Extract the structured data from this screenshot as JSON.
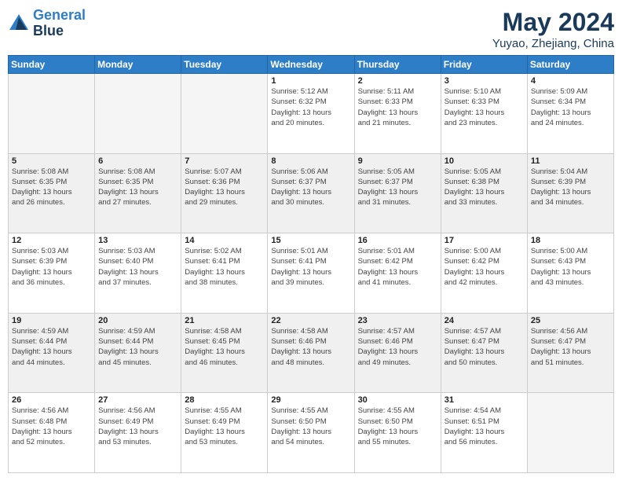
{
  "logo": {
    "line1": "General",
    "line2": "Blue"
  },
  "title": "May 2024",
  "subtitle": "Yuyao, Zhejiang, China",
  "days_header": [
    "Sunday",
    "Monday",
    "Tuesday",
    "Wednesday",
    "Thursday",
    "Friday",
    "Saturday"
  ],
  "weeks": [
    [
      {
        "day": "",
        "info": "",
        "empty": true
      },
      {
        "day": "",
        "info": "",
        "empty": true
      },
      {
        "day": "",
        "info": "",
        "empty": true
      },
      {
        "day": "1",
        "info": "Sunrise: 5:12 AM\nSunset: 6:32 PM\nDaylight: 13 hours\nand 20 minutes.",
        "empty": false
      },
      {
        "day": "2",
        "info": "Sunrise: 5:11 AM\nSunset: 6:33 PM\nDaylight: 13 hours\nand 21 minutes.",
        "empty": false
      },
      {
        "day": "3",
        "info": "Sunrise: 5:10 AM\nSunset: 6:33 PM\nDaylight: 13 hours\nand 23 minutes.",
        "empty": false
      },
      {
        "day": "4",
        "info": "Sunrise: 5:09 AM\nSunset: 6:34 PM\nDaylight: 13 hours\nand 24 minutes.",
        "empty": false
      }
    ],
    [
      {
        "day": "5",
        "info": "Sunrise: 5:08 AM\nSunset: 6:35 PM\nDaylight: 13 hours\nand 26 minutes.",
        "empty": false
      },
      {
        "day": "6",
        "info": "Sunrise: 5:08 AM\nSunset: 6:35 PM\nDaylight: 13 hours\nand 27 minutes.",
        "empty": false
      },
      {
        "day": "7",
        "info": "Sunrise: 5:07 AM\nSunset: 6:36 PM\nDaylight: 13 hours\nand 29 minutes.",
        "empty": false
      },
      {
        "day": "8",
        "info": "Sunrise: 5:06 AM\nSunset: 6:37 PM\nDaylight: 13 hours\nand 30 minutes.",
        "empty": false
      },
      {
        "day": "9",
        "info": "Sunrise: 5:05 AM\nSunset: 6:37 PM\nDaylight: 13 hours\nand 31 minutes.",
        "empty": false
      },
      {
        "day": "10",
        "info": "Sunrise: 5:05 AM\nSunset: 6:38 PM\nDaylight: 13 hours\nand 33 minutes.",
        "empty": false
      },
      {
        "day": "11",
        "info": "Sunrise: 5:04 AM\nSunset: 6:39 PM\nDaylight: 13 hours\nand 34 minutes.",
        "empty": false
      }
    ],
    [
      {
        "day": "12",
        "info": "Sunrise: 5:03 AM\nSunset: 6:39 PM\nDaylight: 13 hours\nand 36 minutes.",
        "empty": false
      },
      {
        "day": "13",
        "info": "Sunrise: 5:03 AM\nSunset: 6:40 PM\nDaylight: 13 hours\nand 37 minutes.",
        "empty": false
      },
      {
        "day": "14",
        "info": "Sunrise: 5:02 AM\nSunset: 6:41 PM\nDaylight: 13 hours\nand 38 minutes.",
        "empty": false
      },
      {
        "day": "15",
        "info": "Sunrise: 5:01 AM\nSunset: 6:41 PM\nDaylight: 13 hours\nand 39 minutes.",
        "empty": false
      },
      {
        "day": "16",
        "info": "Sunrise: 5:01 AM\nSunset: 6:42 PM\nDaylight: 13 hours\nand 41 minutes.",
        "empty": false
      },
      {
        "day": "17",
        "info": "Sunrise: 5:00 AM\nSunset: 6:42 PM\nDaylight: 13 hours\nand 42 minutes.",
        "empty": false
      },
      {
        "day": "18",
        "info": "Sunrise: 5:00 AM\nSunset: 6:43 PM\nDaylight: 13 hours\nand 43 minutes.",
        "empty": false
      }
    ],
    [
      {
        "day": "19",
        "info": "Sunrise: 4:59 AM\nSunset: 6:44 PM\nDaylight: 13 hours\nand 44 minutes.",
        "empty": false
      },
      {
        "day": "20",
        "info": "Sunrise: 4:59 AM\nSunset: 6:44 PM\nDaylight: 13 hours\nand 45 minutes.",
        "empty": false
      },
      {
        "day": "21",
        "info": "Sunrise: 4:58 AM\nSunset: 6:45 PM\nDaylight: 13 hours\nand 46 minutes.",
        "empty": false
      },
      {
        "day": "22",
        "info": "Sunrise: 4:58 AM\nSunset: 6:46 PM\nDaylight: 13 hours\nand 48 minutes.",
        "empty": false
      },
      {
        "day": "23",
        "info": "Sunrise: 4:57 AM\nSunset: 6:46 PM\nDaylight: 13 hours\nand 49 minutes.",
        "empty": false
      },
      {
        "day": "24",
        "info": "Sunrise: 4:57 AM\nSunset: 6:47 PM\nDaylight: 13 hours\nand 50 minutes.",
        "empty": false
      },
      {
        "day": "25",
        "info": "Sunrise: 4:56 AM\nSunset: 6:47 PM\nDaylight: 13 hours\nand 51 minutes.",
        "empty": false
      }
    ],
    [
      {
        "day": "26",
        "info": "Sunrise: 4:56 AM\nSunset: 6:48 PM\nDaylight: 13 hours\nand 52 minutes.",
        "empty": false
      },
      {
        "day": "27",
        "info": "Sunrise: 4:56 AM\nSunset: 6:49 PM\nDaylight: 13 hours\nand 53 minutes.",
        "empty": false
      },
      {
        "day": "28",
        "info": "Sunrise: 4:55 AM\nSunset: 6:49 PM\nDaylight: 13 hours\nand 53 minutes.",
        "empty": false
      },
      {
        "day": "29",
        "info": "Sunrise: 4:55 AM\nSunset: 6:50 PM\nDaylight: 13 hours\nand 54 minutes.",
        "empty": false
      },
      {
        "day": "30",
        "info": "Sunrise: 4:55 AM\nSunset: 6:50 PM\nDaylight: 13 hours\nand 55 minutes.",
        "empty": false
      },
      {
        "day": "31",
        "info": "Sunrise: 4:54 AM\nSunset: 6:51 PM\nDaylight: 13 hours\nand 56 minutes.",
        "empty": false
      },
      {
        "day": "",
        "info": "",
        "empty": true
      }
    ]
  ]
}
